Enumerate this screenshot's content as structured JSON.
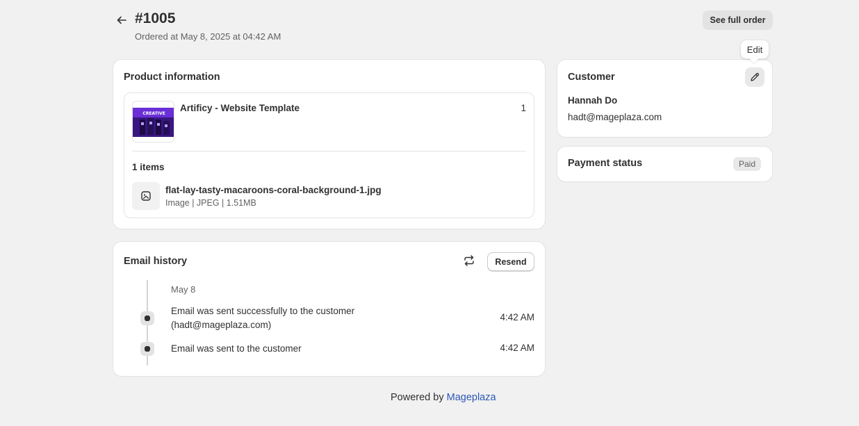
{
  "header": {
    "title": "#1005",
    "subtitle": "Ordered at May 8, 2025 at 04:42 AM",
    "full_order_label": "See full order"
  },
  "product_card": {
    "title": "Product information",
    "product": {
      "name": "Artificy - Website Template",
      "quantity": "1",
      "thumbnail_text": "CREATIVE"
    },
    "items_count": "1 items",
    "file": {
      "name": "flat-lay-tasty-macaroons-coral-background-1.jpg",
      "meta": "Image | JPEG | 1.51MB",
      "icon": "image-file-icon"
    }
  },
  "email_history": {
    "title": "Email history",
    "resend_label": "Resend",
    "refresh_icon": "refresh-icon",
    "date": "May 8",
    "events": [
      {
        "text": "Email was sent successfully to the customer (hadt@mageplaza.com)",
        "time": "4:42 AM"
      },
      {
        "text": "Email was sent to the customer",
        "time": "4:42 AM"
      }
    ]
  },
  "customer": {
    "title": "Customer",
    "name": "Hannah Do",
    "email": "hadt@mageplaza.com",
    "edit_tooltip": "Edit"
  },
  "payment": {
    "title": "Payment status",
    "status": "Paid"
  },
  "footer": {
    "prefix": "Powered by",
    "link": "Mageplaza"
  },
  "colors": {
    "background": "#f1f1f1",
    "card": "#ffffff",
    "text": "#303030",
    "muted": "#616161",
    "link": "#2c57b5",
    "thumbnail_accent": "#6a2fd6"
  }
}
